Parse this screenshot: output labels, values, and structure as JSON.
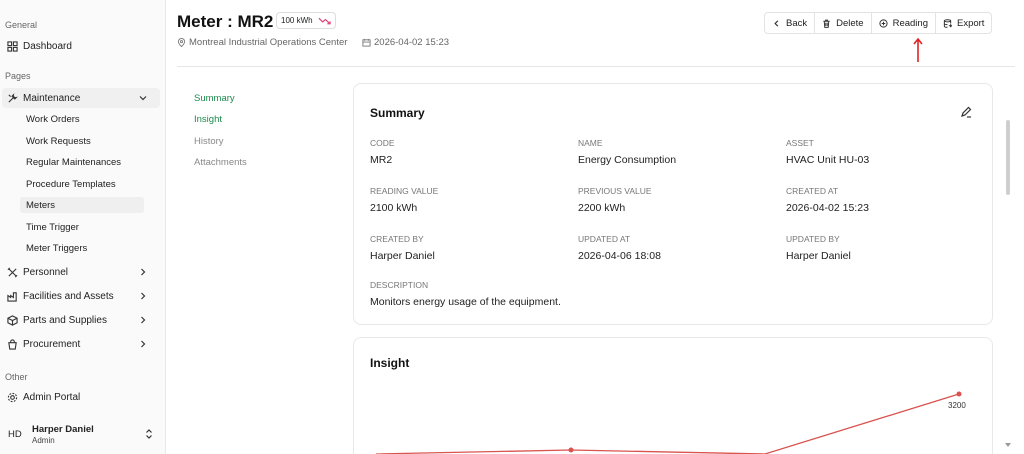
{
  "sidebar": {
    "sections": {
      "general": "General",
      "pages": "Pages",
      "other": "Other"
    },
    "dashboard": "Dashboard",
    "maintenance": "Maintenance",
    "maintenance_items": [
      "Work Orders",
      "Work Requests",
      "Regular Maintenances",
      "Procedure Templates",
      "Meters",
      "Time Trigger",
      "Meter Triggers"
    ],
    "personnel": "Personnel",
    "facilities": "Facilities and Assets",
    "parts": "Parts and Supplies",
    "procurement": "Procurement",
    "admin_portal": "Admin Portal",
    "user": {
      "initials": "HD",
      "name": "Harper Daniel",
      "role": "Admin"
    }
  },
  "header": {
    "title": "Meter : MR2",
    "badge": "100 kWh",
    "location": "Montreal Industrial Operations Center",
    "datetime": "2026-04-02 15:23",
    "buttons": {
      "back": "Back",
      "delete": "Delete",
      "reading": "Reading",
      "export": "Export"
    }
  },
  "anchors": [
    "Summary",
    "Insight",
    "History",
    "Attachments"
  ],
  "summary": {
    "title": "Summary",
    "fields": [
      {
        "label": "CODE",
        "value": "MR2"
      },
      {
        "label": "NAME",
        "value": "Energy Consumption"
      },
      {
        "label": "ASSET",
        "value": "HVAC Unit HU-03"
      },
      {
        "label": "READING VALUE",
        "value": "2100 kWh"
      },
      {
        "label": "PREVIOUS VALUE",
        "value": "2200 kWh"
      },
      {
        "label": "CREATED AT",
        "value": "2026-04-02 15:23"
      },
      {
        "label": "CREATED BY",
        "value": "Harper Daniel"
      },
      {
        "label": "UPDATED AT",
        "value": "2026-04-06 18:08"
      },
      {
        "label": "UPDATED BY",
        "value": "Harper Daniel"
      }
    ],
    "description_label": "DESCRIPTION",
    "description": "Monitors energy usage of the equipment."
  },
  "insight": {
    "title": "Insight",
    "visible_label": "3200",
    "line_color": "#d9534f"
  },
  "colors": {
    "accent_green": "#1c8a4c",
    "annotation_red": "#e02424"
  }
}
